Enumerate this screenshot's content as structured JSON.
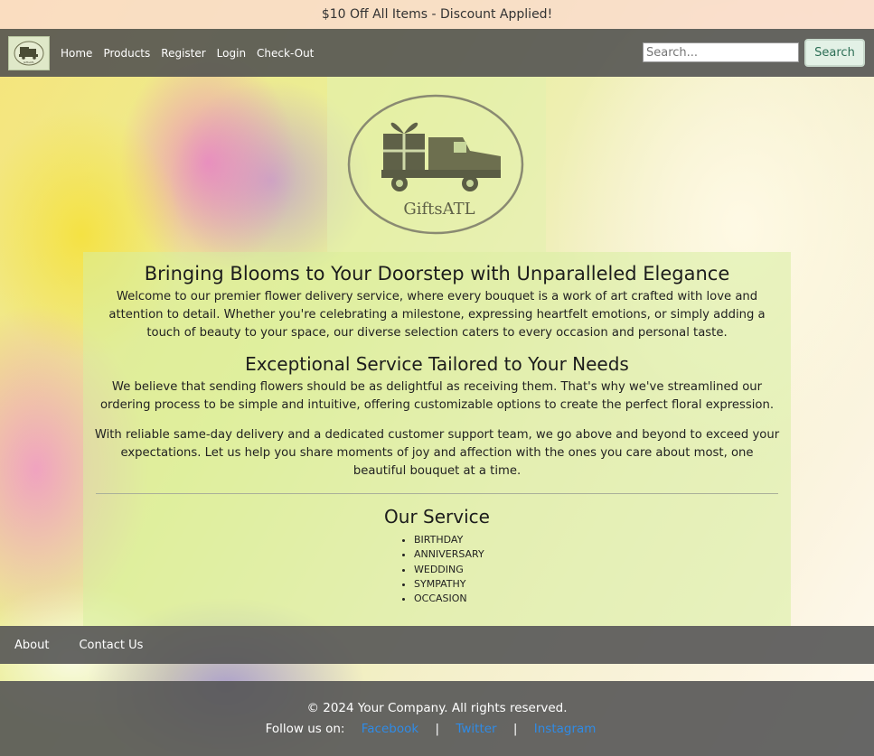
{
  "promo": {
    "text": "$10 Off All Items - Discount Applied!"
  },
  "nav": {
    "logo_text": "GiftsATL",
    "links": [
      "Home",
      "Products",
      "Register",
      "Login",
      "Check-Out"
    ],
    "search_placeholder": "Search...",
    "search_button": "Search"
  },
  "hero_logo": {
    "text": "GiftsATL"
  },
  "content": {
    "heading1": "Bringing Blooms to Your Doorstep with Unparalleled Elegance",
    "para1": "Welcome to our premier flower delivery service, where every bouquet is a work of art crafted with love and attention to detail. Whether you're celebrating a milestone, expressing heartfelt emotions, or simply adding a touch of beauty to your space, our diverse selection caters to every occasion and personal taste.",
    "heading2": "Exceptional Service Tailored to Your Needs",
    "para2": "We believe that sending flowers should be as delightful as receiving them. That's why we've streamlined our ordering process to be simple and intuitive, offering customizable options to create the perfect floral expression.",
    "para3": "With reliable same-day delivery and a dedicated customer support team, we go above and beyond to exceed your expectations. Let us help you share moments of joy and affection with the ones you care about most, one beautiful bouquet at a time.",
    "services_heading": "Our Service",
    "services": [
      "BIRTHDAY",
      "ANNIVERSARY",
      "WEDDING",
      "SYMPATHY",
      "OCCASION"
    ]
  },
  "footer_nav": {
    "links": [
      "About",
      "Contact Us"
    ]
  },
  "footer": {
    "copyright": "© 2024 Your Company. All rights reserved.",
    "follow_label": "Follow us on:",
    "social": [
      "Facebook",
      "Twitter",
      "Instagram"
    ],
    "separator": "|"
  },
  "colors": {
    "navbar": "#505050",
    "logo_olive": "#6d6f4f",
    "search_button_text": "#2d6f56",
    "social_link": "#2f8be6"
  }
}
